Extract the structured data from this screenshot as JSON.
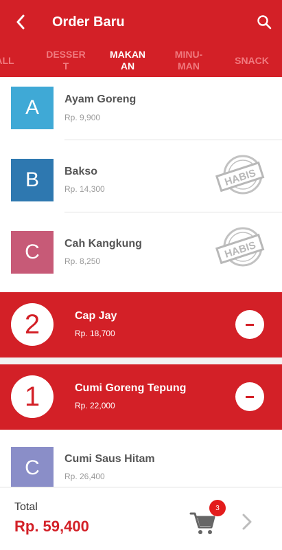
{
  "app_bar": {
    "title": "Order Baru",
    "back_icon": "arrow-left-icon",
    "search_icon": "search-icon"
  },
  "tabs": [
    {
      "label": "ALL",
      "active": false
    },
    {
      "label": "DESSERT",
      "active": false
    },
    {
      "label": "MAKANAN",
      "active": true
    },
    {
      "label": "MINUMAN",
      "active": false
    },
    {
      "label": "SNACK",
      "active": false
    }
  ],
  "tab_display": [
    "ALL",
    "DESSER\nT",
    "MAKAN\nAN",
    "MINU-\nMAN",
    "SNACK"
  ],
  "menu_items": [
    {
      "letter": "A",
      "name": "Ayam Goreng",
      "price": "Rp. 9,900",
      "color": "#3fa9d6",
      "sold_out": false
    },
    {
      "letter": "B",
      "name": "Bakso",
      "price": "Rp. 14,300",
      "color": "#2e78b0",
      "sold_out": true
    },
    {
      "letter": "C",
      "name": "Cah Kangkung",
      "price": "Rp. 8,250",
      "color": "#c75a77",
      "sold_out": true
    },
    {
      "letter": "C",
      "name": "Cumi Saus Hitam",
      "price": "Rp. 26,400",
      "color": "#8a8ec8",
      "sold_out": false
    }
  ],
  "selected_items": [
    {
      "qty": "2",
      "name": "Cap Jay",
      "price": "Rp. 18,700"
    },
    {
      "qty": "1",
      "name": "Cumi Goreng Tepung",
      "price": "Rp. 22,000"
    }
  ],
  "stamp_text": "HABIS",
  "footer": {
    "total_label": "Total",
    "total_value": "Rp. 59,400",
    "cart_count": "3",
    "cart_icon": "cart-icon",
    "next_icon": "chevron-right-icon"
  },
  "colors": {
    "primary": "#d32027",
    "tab_inactive": "#f07a7f",
    "badge": "#e31c1c"
  }
}
